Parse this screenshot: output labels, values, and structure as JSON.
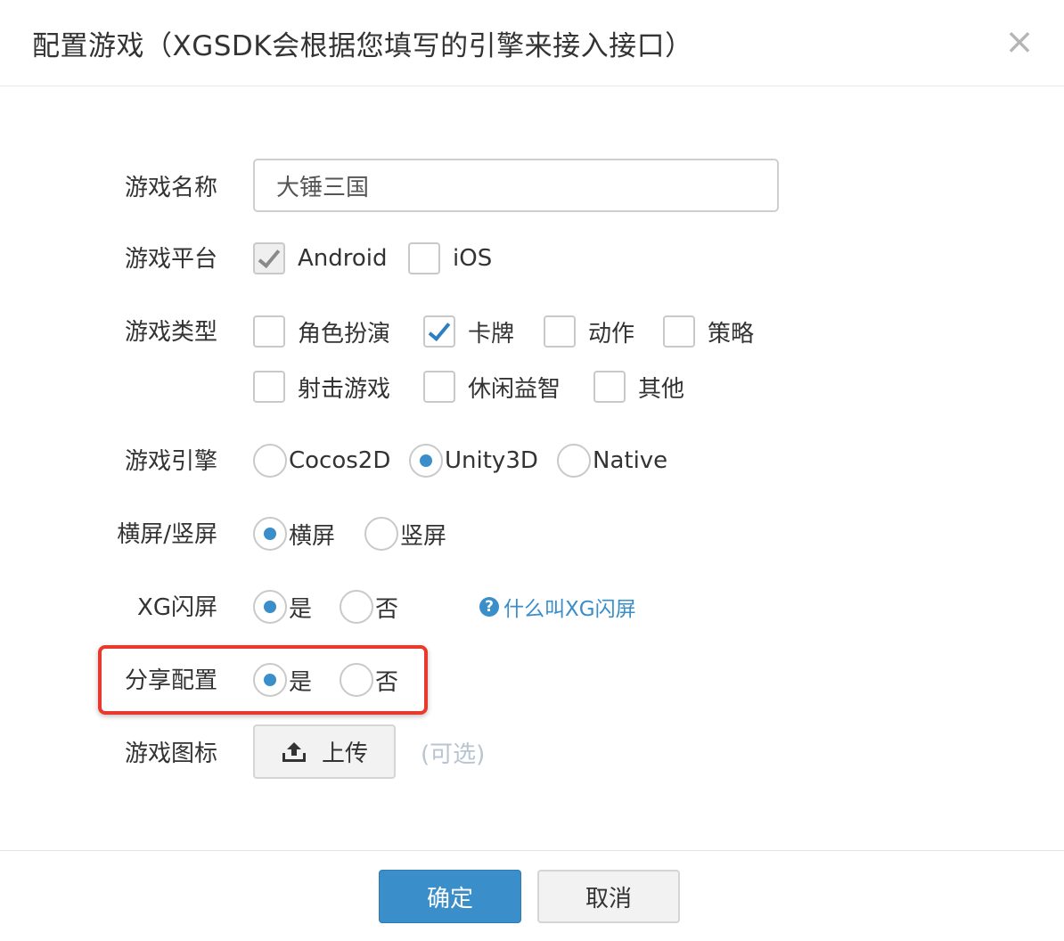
{
  "dialog": {
    "title": "配置游戏（XGSDK会根据您填写的引擎来接入接口）",
    "close_glyph": "×"
  },
  "game_name": {
    "label": "游戏名称",
    "value": "大锤三国"
  },
  "platform": {
    "label": "游戏平台",
    "options": [
      {
        "label": "Android",
        "checked": true
      },
      {
        "label": "iOS",
        "checked": false
      }
    ]
  },
  "game_type": {
    "label": "游戏类型",
    "options": [
      {
        "label": "角色扮演",
        "checked": false
      },
      {
        "label": "卡牌",
        "checked": true
      },
      {
        "label": "动作",
        "checked": false
      },
      {
        "label": "策略",
        "checked": false
      },
      {
        "label": "射击游戏",
        "checked": false
      },
      {
        "label": "休闲益智",
        "checked": false
      },
      {
        "label": "其他",
        "checked": false
      }
    ]
  },
  "engine": {
    "label": "游戏引擎",
    "options": [
      {
        "label": "Cocos2D",
        "selected": false
      },
      {
        "label": "Unity3D",
        "selected": true
      },
      {
        "label": "Native",
        "selected": false
      }
    ]
  },
  "orientation": {
    "label": "横屏/竖屏",
    "options": [
      {
        "label": "横屏",
        "selected": true
      },
      {
        "label": "竖屏",
        "selected": false
      }
    ]
  },
  "xg_splash": {
    "label": "XG闪屏",
    "options": [
      {
        "label": "是",
        "selected": true
      },
      {
        "label": "否",
        "selected": false
      }
    ],
    "help_icon": "?",
    "help_text": "什么叫XG闪屏"
  },
  "share_config": {
    "label": "分享配置",
    "options": [
      {
        "label": "是",
        "selected": true
      },
      {
        "label": "否",
        "selected": false
      }
    ]
  },
  "game_icon": {
    "label": "游戏图标",
    "upload_label": "上传",
    "upload_icon": "upload-icon",
    "optional_note": "(可选)"
  },
  "footer": {
    "confirm_label": "确定",
    "cancel_label": "取消"
  },
  "colors": {
    "accent": "#3a8ec9",
    "highlight": "#e8392c",
    "optional_text": "#b8c4d0"
  }
}
